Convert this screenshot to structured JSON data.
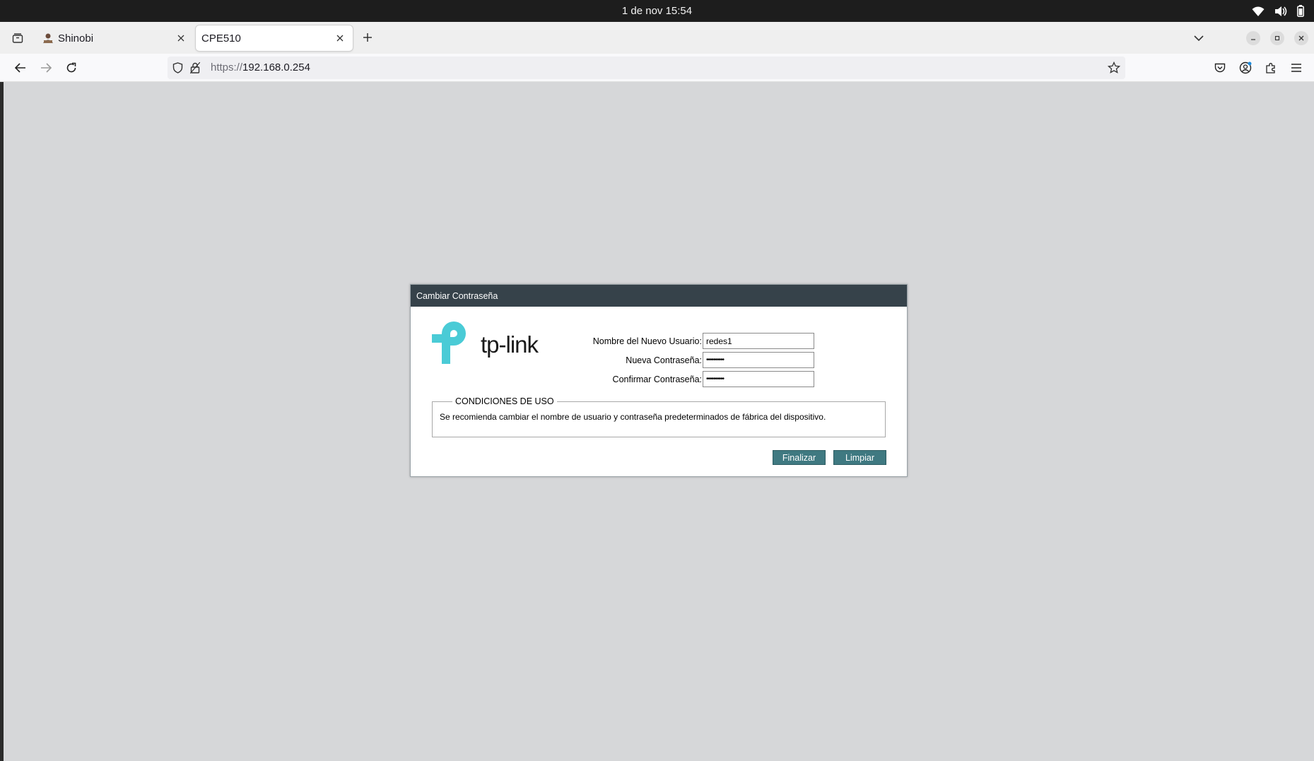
{
  "system": {
    "clock": "1 de nov  15:54",
    "icons": [
      "wifi-icon",
      "volume-icon",
      "battery-icon"
    ]
  },
  "browser": {
    "tabs": [
      {
        "label": "Shinobi",
        "active": false,
        "favicon": "shinobi-favicon"
      },
      {
        "label": "CPE510",
        "active": true
      }
    ],
    "url_scheme": "https://",
    "url_host": "192.168.0.254"
  },
  "dialog": {
    "title": "Cambiar Contraseña",
    "logo_text": "tp-link",
    "fields": {
      "username_label": "Nombre del Nuevo Usuario:",
      "username_value": "redes1",
      "new_password_label": "Nueva Contraseña:",
      "new_password_value": "••••••••••",
      "confirm_password_label": "Confirmar Contraseña:",
      "confirm_password_value": "••••••••••"
    },
    "conditions": {
      "legend": "CONDICIONES DE USO",
      "text": "Se recomienda cambiar el nombre de usuario y contraseña predeterminados de fábrica del dispositivo."
    },
    "buttons": {
      "finish": "Finalizar",
      "clear": "Limpiar"
    }
  },
  "colors": {
    "dialog_header": "#36424a",
    "button_bg": "#3f7981",
    "logo_teal": "#4acbd6",
    "page_bg": "#d6d7d9"
  }
}
